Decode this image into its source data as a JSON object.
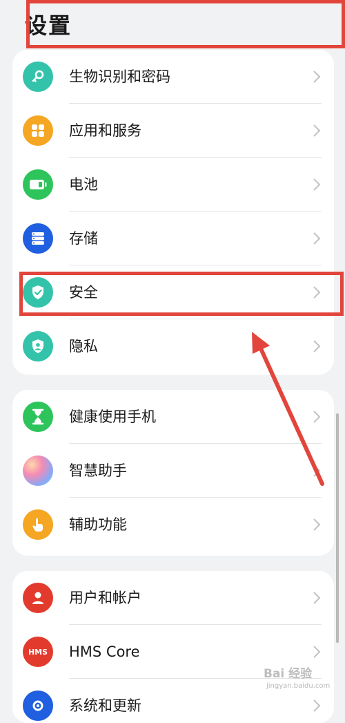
{
  "header": {
    "title": "设置"
  },
  "colors": {
    "highlight": "#e2453b",
    "teal": "#33c3aa",
    "orange": "#f5a623",
    "green": "#2ec45c",
    "blue": "#1f5fe0",
    "red": "#e23b2e"
  },
  "groups": [
    {
      "items": [
        {
          "label": "生物识别和密码",
          "icon": "key-icon"
        },
        {
          "label": "应用和服务",
          "icon": "apps-icon"
        },
        {
          "label": "电池",
          "icon": "battery-icon"
        },
        {
          "label": "存储",
          "icon": "storage-icon"
        },
        {
          "label": "安全",
          "icon": "shield-check-icon"
        },
        {
          "label": "隐私",
          "icon": "privacy-icon"
        }
      ]
    },
    {
      "items": [
        {
          "label": "健康使用手机",
          "icon": "hourglass-icon"
        },
        {
          "label": "智慧助手",
          "icon": "assistant-orb-icon"
        },
        {
          "label": "辅助功能",
          "icon": "hand-icon"
        }
      ]
    },
    {
      "items": [
        {
          "label": "用户和帐户",
          "icon": "user-icon"
        },
        {
          "label": "HMS Core",
          "icon": "hms-icon",
          "icon_text": "HMS"
        },
        {
          "label": "系统和更新",
          "icon": "system-update-icon"
        }
      ]
    }
  ],
  "watermark": {
    "top": "Bai 经验",
    "bottom": "jingyan.baidu.com"
  }
}
